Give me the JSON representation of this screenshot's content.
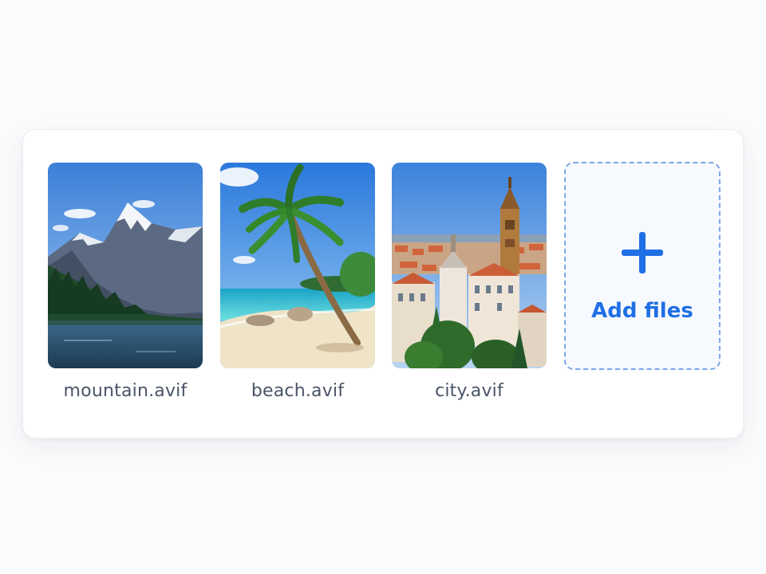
{
  "files": [
    {
      "name": "mountain.avif",
      "thumbnail": "mountain-lake-photo"
    },
    {
      "name": "beach.avif",
      "thumbnail": "palm-beach-photo"
    },
    {
      "name": "city.avif",
      "thumbnail": "old-town-city-photo"
    }
  ],
  "add_files": {
    "label": "Add files",
    "icon": "plus-icon"
  },
  "colors": {
    "accent": "#1f6fe5",
    "dashed_border": "#7ea6e8",
    "filename_text": "#4a5466",
    "panel_background": "#ffffff",
    "page_background": "#fafbfc"
  }
}
